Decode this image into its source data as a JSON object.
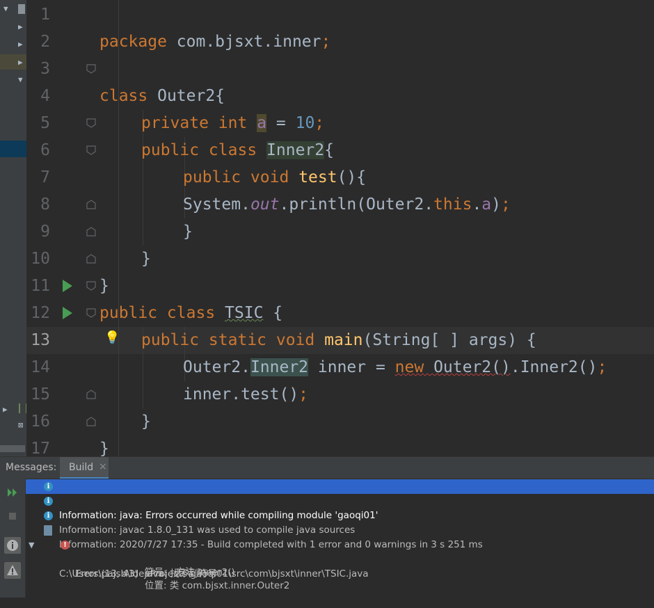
{
  "editor": {
    "lines": [
      {
        "n": "1"
      },
      {
        "n": "2"
      },
      {
        "n": "3"
      },
      {
        "n": "4"
      },
      {
        "n": "5"
      },
      {
        "n": "6"
      },
      {
        "n": "7"
      },
      {
        "n": "8"
      },
      {
        "n": "9"
      },
      {
        "n": "10"
      },
      {
        "n": "11"
      },
      {
        "n": "12"
      },
      {
        "n": "13"
      },
      {
        "n": "14"
      },
      {
        "n": "15"
      },
      {
        "n": "16"
      },
      {
        "n": "17"
      }
    ],
    "code": {
      "l1": {
        "kw": "package",
        "rest": " com.bjsxt.inner",
        "semi": ";"
      },
      "l3": {
        "kw": "class",
        "rest": " Outer2{"
      },
      "l4": {
        "kw": "private int",
        "var": "a",
        "eq": " = ",
        "num": "10",
        "semi": ";"
      },
      "l5": {
        "kw": "public class",
        "cls": "Inner2",
        "brace": "{"
      },
      "l6": {
        "kw": "public void",
        "fn": "test",
        "rest": "(){"
      },
      "l7": {
        "a": "System.",
        "out": "out",
        "b": ".println(Outer2.",
        "this": "this",
        "c": ".",
        "fld": "a",
        "d": ")",
        "semi": ";"
      },
      "l8": {
        "t": "}"
      },
      "l9": {
        "t": "}"
      },
      "l10": {
        "t": "}"
      },
      "l11": {
        "kw": "public class",
        "cls": "TSIC",
        "rest": " {"
      },
      "l12": {
        "kw": "public static void",
        "fn": "main",
        "rest": "(String[ ] args) {"
      },
      "l13": {
        "a": "Outer2.",
        "inner": "Inner2",
        "b": " inner = ",
        "new": "new",
        "c": " ",
        "ctor": "Outer2()",
        "d": ".Inner2()",
        "semi": ";"
      },
      "l14": {
        "a": "inner.test()",
        "semi": ";"
      },
      "l15": {
        "t": "}"
      },
      "l16": {
        "t": "}"
      }
    },
    "current_line": "13"
  },
  "messages": {
    "label": "Messages:",
    "tab": "Build",
    "rows": [
      {
        "text": "Information: java: Errors occurred while compiling module 'gaoqi01'"
      },
      {
        "text": "Information: javac 1.8.0_131 was used to compile java sources"
      },
      {
        "text": "Information: 2020/7/27 17:35 - Build completed with 1 error and 0 warnings in 3 s 251 ms"
      },
      {
        "text": "C:\\Users\\pajsb\\IdeaProjects\\gaoqi01\\src\\com\\bjsxt\\inner\\TSIC.java"
      },
      {
        "text": "Error:(13, 43)  java: 找不到符号"
      },
      {
        "text": "符号:   方法 Inner2()"
      },
      {
        "text": "位置: 类 com.bjsxt.inner.Outer2"
      }
    ]
  },
  "colors": {
    "background": "#2b2b2b",
    "keyword": "#cc7832",
    "number": "#6897bb",
    "field": "#9876aa",
    "method": "#ffc66d",
    "selection": "#2f65ca"
  }
}
